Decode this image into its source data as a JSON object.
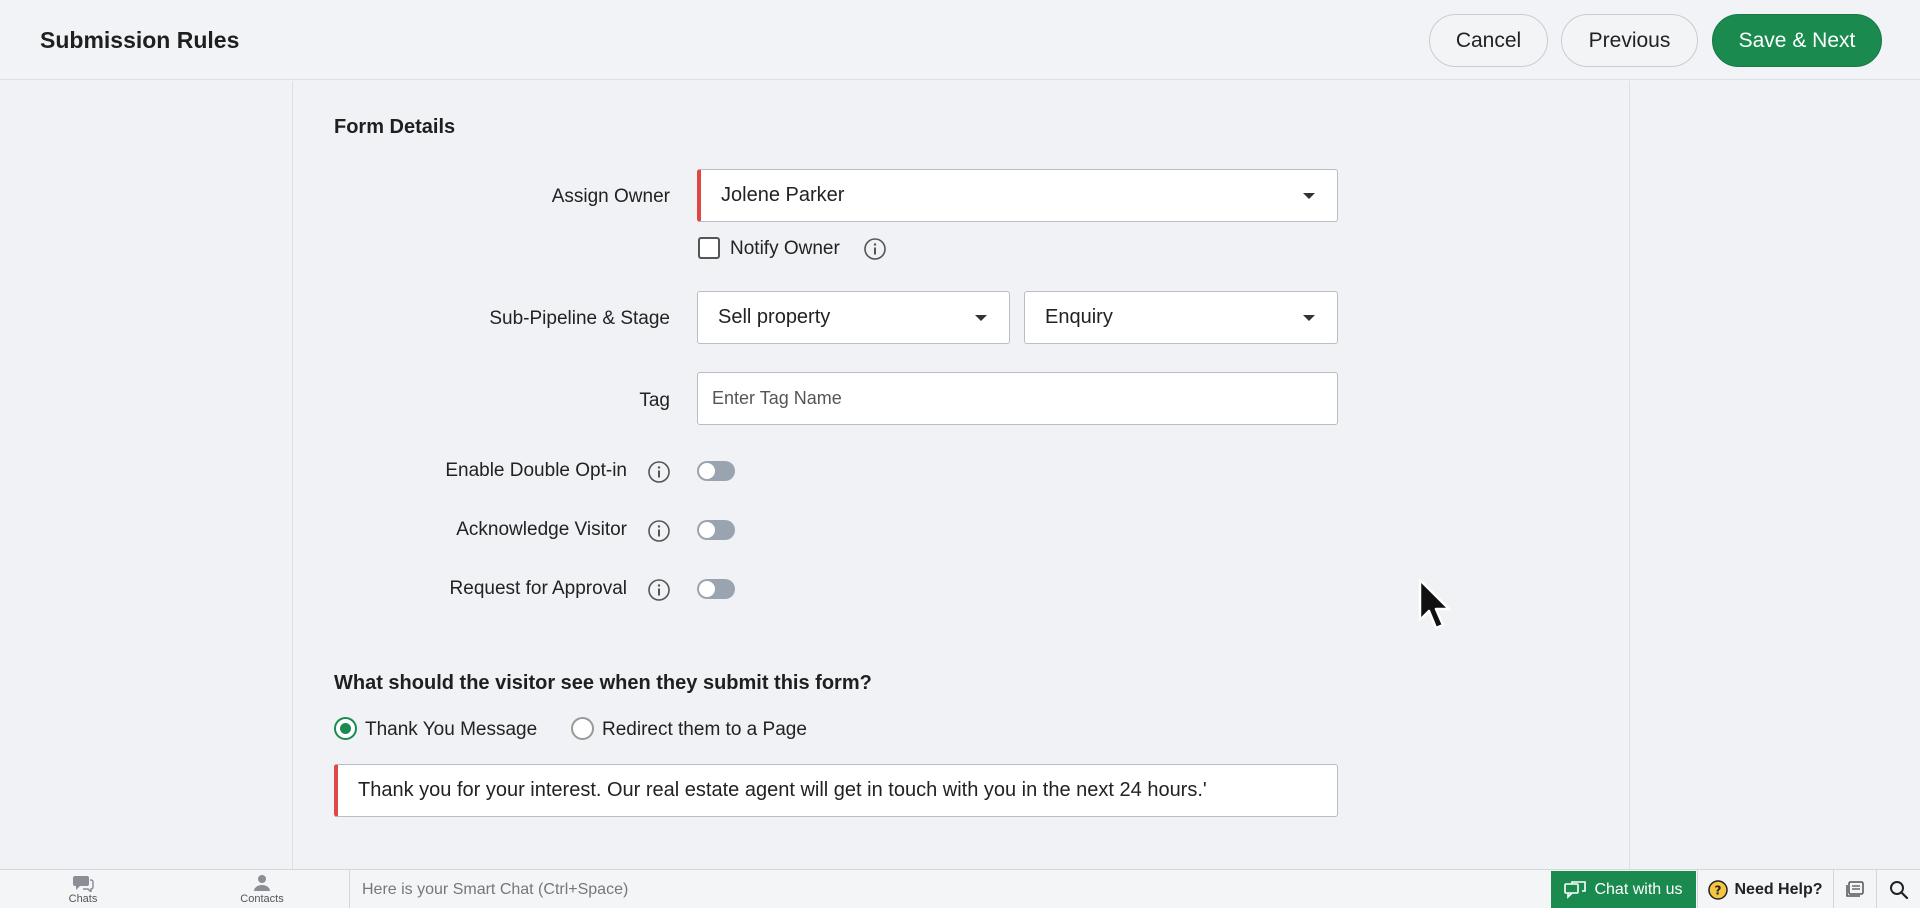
{
  "header": {
    "title": "Submission Rules",
    "cancel_label": "Cancel",
    "previous_label": "Previous",
    "save_next_label": "Save & Next"
  },
  "form": {
    "section_title": "Form Details",
    "assign_owner": {
      "label": "Assign Owner",
      "value": "Jolene Parker"
    },
    "notify_owner": {
      "label": "Notify Owner",
      "checked": false
    },
    "sub_pipeline": {
      "label": "Sub-Pipeline & Stage",
      "pipeline_value": "Sell property",
      "stage_value": "Enquiry"
    },
    "tag": {
      "label": "Tag",
      "placeholder": "Enter Tag Name",
      "value": ""
    },
    "toggles": [
      {
        "label": "Enable Double Opt-in",
        "on": false
      },
      {
        "label": "Acknowledge Visitor",
        "on": false
      },
      {
        "label": "Request for Approval",
        "on": false
      }
    ]
  },
  "submission": {
    "question": "What should the visitor see when they submit this form?",
    "options": [
      {
        "label": "Thank You Message",
        "selected": true
      },
      {
        "label": "Redirect them to a Page",
        "selected": false
      }
    ],
    "message": "Thank you for your interest. Our real estate agent will get in touch with you in the next 24 hours.'"
  },
  "bottombar": {
    "chats_label": "Chats",
    "contacts_label": "Contacts",
    "smart_chat_placeholder": "Here is your Smart Chat (Ctrl+Space)",
    "chat_with_us_label": "Chat with us",
    "need_help_label": "Need Help?"
  },
  "colors": {
    "primary_green": "#1a8a4f",
    "required_red": "#e04848",
    "toggle_off": "#9aa4b0"
  },
  "icons": [
    "info-icon",
    "caret-down-icon",
    "chats-icon",
    "contacts-icon",
    "chat-bubble-icon",
    "help-icon",
    "feed-icon",
    "search-icon",
    "mouse-cursor"
  ]
}
